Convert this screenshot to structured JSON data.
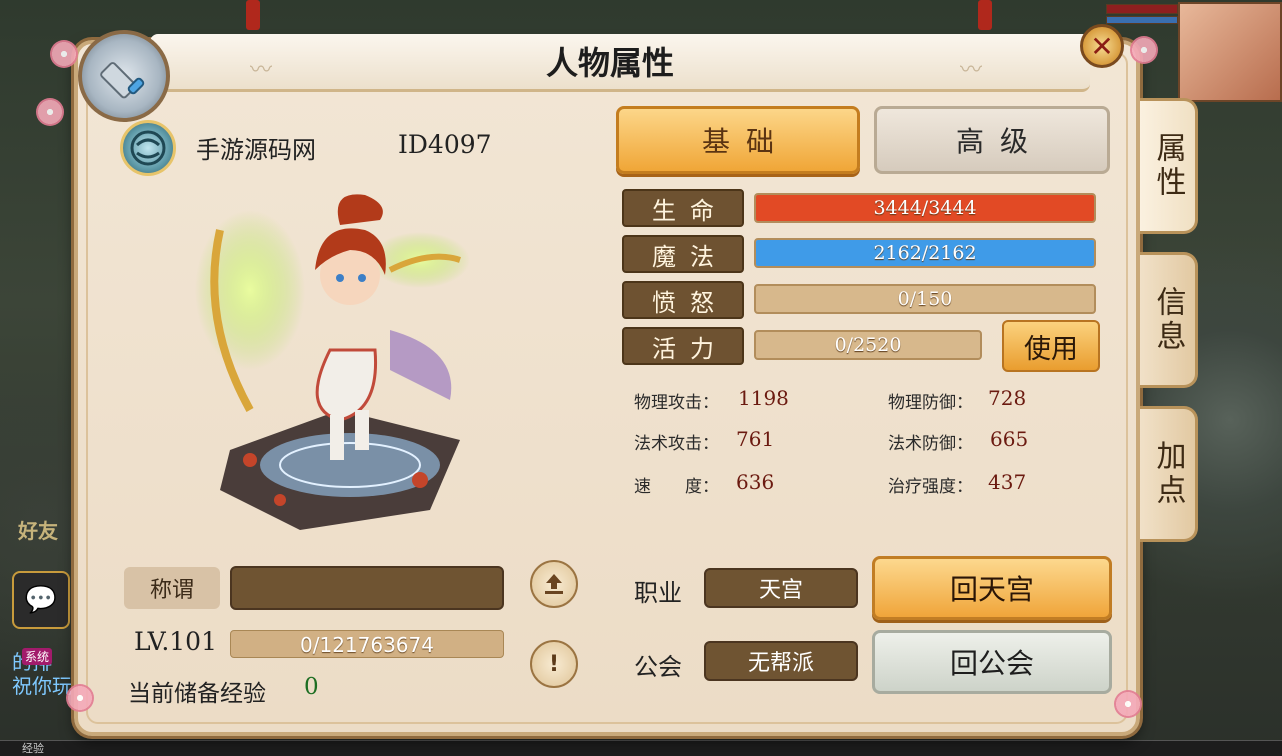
{
  "window": {
    "title": "人物属性",
    "close_symbol": "✕"
  },
  "player": {
    "name": "手游源码网",
    "id": "ID4097"
  },
  "tabs": [
    {
      "label": "基础",
      "active": true
    },
    {
      "label": "高级",
      "active": false
    }
  ],
  "side_tabs": [
    {
      "label": "属性",
      "active": true
    },
    {
      "label": "信息",
      "active": false
    },
    {
      "label": "加点",
      "active": false
    }
  ],
  "stats": [
    {
      "label": "生命",
      "value": "3444/3444",
      "fill": 1.0,
      "color": "#e24a25"
    },
    {
      "label": "魔法",
      "value": "2162/2162",
      "fill": 1.0,
      "color": "#3f9be8"
    },
    {
      "label": "愤怒",
      "value": "0/150",
      "fill": 0.0,
      "color": "#d7b88c"
    },
    {
      "label": "活力",
      "value": "0/2520",
      "fill": 0.0,
      "color": "#d7b88c"
    }
  ],
  "use_button": "使用",
  "attributes": [
    {
      "label": "物理攻击：",
      "value": "1198"
    },
    {
      "label": "物理防御：",
      "value": "728"
    },
    {
      "label": "法术攻击：",
      "value": "761"
    },
    {
      "label": "法术防御：",
      "value": "665"
    },
    {
      "label": "速　　度：",
      "value": "636"
    },
    {
      "label": "治疗强度：",
      "value": "437"
    }
  ],
  "title_row": {
    "label": "称谓",
    "value": ""
  },
  "level": {
    "label": "LV.101",
    "exp": "0/121763674",
    "exp_fill": 0.0
  },
  "reserve": {
    "label": "当前储备经验",
    "value": "0"
  },
  "job": {
    "label": "职业",
    "value": "天宫",
    "button": "回天宫"
  },
  "guild": {
    "label": "公会",
    "value": "无帮派",
    "button": "回公会"
  },
  "background": {
    "friend_label": "好友",
    "chat_tag": "系统",
    "chat_text": "的排\n祝你玩",
    "exp_strip_label": "经验"
  },
  "colors": {
    "accent": "#f0a637",
    "panel_bg": "#ecdcc6",
    "stat_label_bg": "#6e5231"
  },
  "icons": {
    "emblem": "sword-emblem-icon",
    "avatar": "guild-avatar-icon",
    "upload": "upload-icon",
    "info": "exclamation-icon",
    "chat": "chat-bubble-icon"
  }
}
